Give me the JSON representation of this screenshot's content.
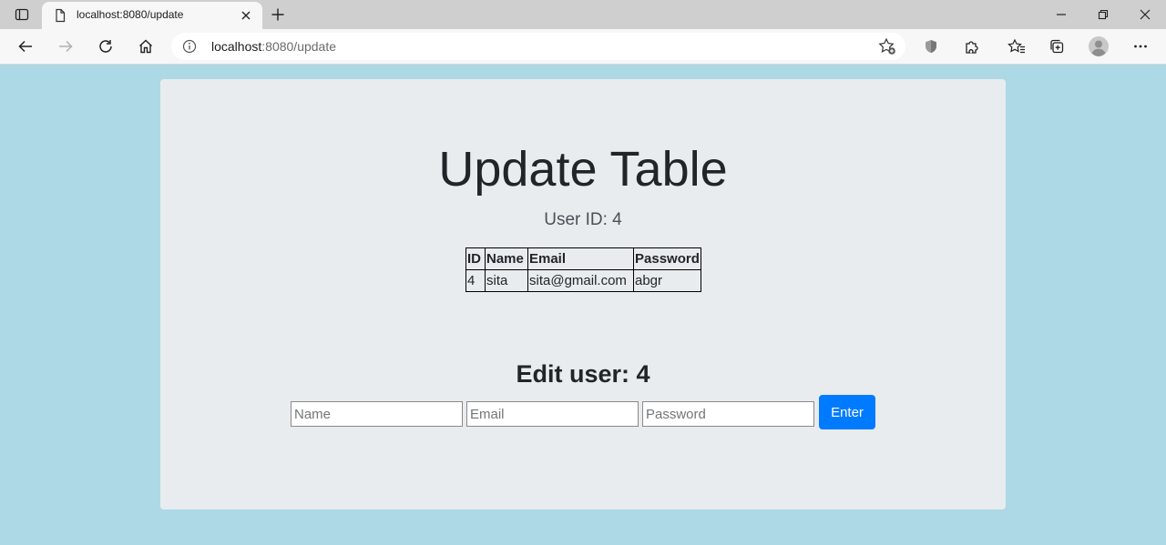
{
  "browser": {
    "tab_title": "localhost:8080/update",
    "url_host": "localhost",
    "url_path": ":8080/update"
  },
  "page": {
    "title": "Update Table",
    "subtitle": "User ID: 4",
    "table": {
      "headers": [
        "ID",
        "Name",
        "Email",
        "Password"
      ],
      "rows": [
        [
          "4",
          "sita",
          "sita@gmail.com",
          "abgr"
        ]
      ]
    },
    "edit_heading": "Edit user: 4",
    "form": {
      "name_placeholder": "Name",
      "email_placeholder": "Email",
      "password_placeholder": "Password",
      "submit_label": "Enter"
    }
  },
  "colors": {
    "page_background": "#add8e6",
    "panel_background": "#e9ecef",
    "button_primary": "#007bff"
  }
}
